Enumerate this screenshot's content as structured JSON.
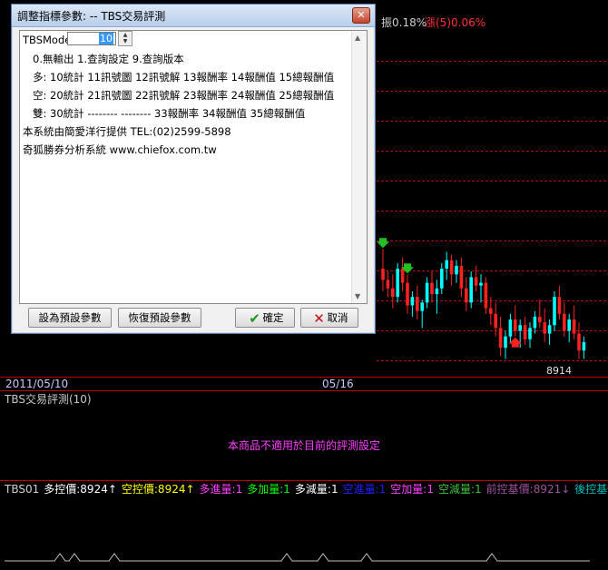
{
  "dialog": {
    "title": "調整指標參數: -- TBS交易評測",
    "close_glyph": "✕",
    "mode_label": "TBSMode:",
    "mode_value": "10",
    "lines": [
      "0.無輸出 1.查詢設定 9.查詢版本",
      "多: 10統計 11訊號圖 12訊號解 13報酬率 14報酬值 15總報酬值",
      "空: 20統計 21訊號圖 22訊號解 23報酬率 24報酬值 25總報酬值",
      "雙: 30統計 -------- -------- 33報酬率 34報酬值 35總報酬值",
      "本系統由簡愛洋行提供 TEL:(02)2599-5898",
      "奇狐勝券分析系統 www.chiefox.com.tw"
    ],
    "buttons": {
      "set_default": "設為預設參數",
      "restore_default": "恢復預設參數",
      "ok": "確定",
      "cancel": "取消"
    }
  },
  "price_panel": {
    "header_left_a": "振0.18%",
    "header_left_b": "漲(5)0.06%",
    "low_label": "8914"
  },
  "date_axis": {
    "start": "2011/05/10",
    "mid": "05/16"
  },
  "tbs_panel": {
    "title": "TBS交易評測(10)",
    "message": "本商品不適用於目前的評測設定"
  },
  "legend": [
    {
      "text": "TBS01",
      "color": "#d0d0d0"
    },
    {
      "text": "多控價:8924↑",
      "color": "#ffffff"
    },
    {
      "text": "空控價:8924↑",
      "color": "#ffff00"
    },
    {
      "text": "多進量:1",
      "color": "#ff40ff"
    },
    {
      "text": "多加量:1",
      "color": "#00ff00"
    },
    {
      "text": "多減量:1",
      "color": "#ffffff"
    },
    {
      "text": "空進量:1",
      "color": "#2020ff"
    },
    {
      "text": "空加量:1",
      "color": "#ff40ff"
    },
    {
      "text": "空減量:1",
      "color": "#40c040"
    },
    {
      "text": "前控基價:8921↓",
      "color": "#a050a0"
    },
    {
      "text": "後控基價:",
      "color": "#00c0c0"
    }
  ],
  "colors": {
    "up": "#00ffff",
    "down": "#ff2020",
    "grid": "#b01010",
    "buy_arrow": "#20c020",
    "sell_arrow": "#ff2020"
  },
  "chart_data": {
    "type": "candlestick",
    "candles": [
      [
        8946,
        8953,
        8938,
        8942
      ],
      [
        8942,
        8945,
        8936,
        8939
      ],
      [
        8939,
        8944,
        8932,
        8936
      ],
      [
        8936,
        8948,
        8934,
        8946
      ],
      [
        8946,
        8950,
        8938,
        8941
      ],
      [
        8941,
        8944,
        8930,
        8933
      ],
      [
        8933,
        8938,
        8929,
        8936
      ],
      [
        8936,
        8940,
        8928,
        8931
      ],
      [
        8931,
        8935,
        8925,
        8934
      ],
      [
        8934,
        8943,
        8932,
        8941
      ],
      [
        8941,
        8945,
        8934,
        8937
      ],
      [
        8937,
        8942,
        8930,
        8939
      ],
      [
        8939,
        8948,
        8937,
        8946
      ],
      [
        8946,
        8952,
        8942,
        8949
      ],
      [
        8949,
        8951,
        8940,
        8944
      ],
      [
        8944,
        8949,
        8941,
        8947
      ],
      [
        8947,
        8950,
        8936,
        8939
      ],
      [
        8939,
        8943,
        8931,
        8934
      ],
      [
        8934,
        8945,
        8932,
        8943
      ],
      [
        8943,
        8947,
        8938,
        8940
      ],
      [
        8940,
        8944,
        8934,
        8941
      ],
      [
        8941,
        8943,
        8930,
        8932
      ],
      [
        8932,
        8936,
        8926,
        8930
      ],
      [
        8930,
        8934,
        8922,
        8925
      ],
      [
        8925,
        8929,
        8915,
        8918
      ],
      [
        8918,
        8924,
        8914,
        8922
      ],
      [
        8922,
        8930,
        8920,
        8928
      ],
      [
        8928,
        8933,
        8922,
        8924
      ],
      [
        8924,
        8928,
        8918,
        8926
      ],
      [
        8926,
        8929,
        8919,
        8921
      ],
      [
        8921,
        8927,
        8918,
        8925
      ],
      [
        8925,
        8931,
        8923,
        8929
      ],
      [
        8929,
        8935,
        8925,
        8927
      ],
      [
        8927,
        8932,
        8920,
        8923
      ],
      [
        8923,
        8928,
        8919,
        8926
      ],
      [
        8926,
        8938,
        8924,
        8936
      ],
      [
        8936,
        8940,
        8928,
        8930
      ],
      [
        8930,
        8934,
        8922,
        8924
      ],
      [
        8924,
        8930,
        8920,
        8928
      ],
      [
        8928,
        8933,
        8921,
        8923
      ],
      [
        8923,
        8927,
        8914,
        8917
      ],
      [
        8917,
        8922,
        8914,
        8920
      ]
    ],
    "signals": [
      {
        "index": 0,
        "type": "buy"
      },
      {
        "index": 5,
        "type": "buy"
      },
      {
        "index": 27,
        "type": "sell"
      }
    ],
    "low_annotation": 8914
  }
}
